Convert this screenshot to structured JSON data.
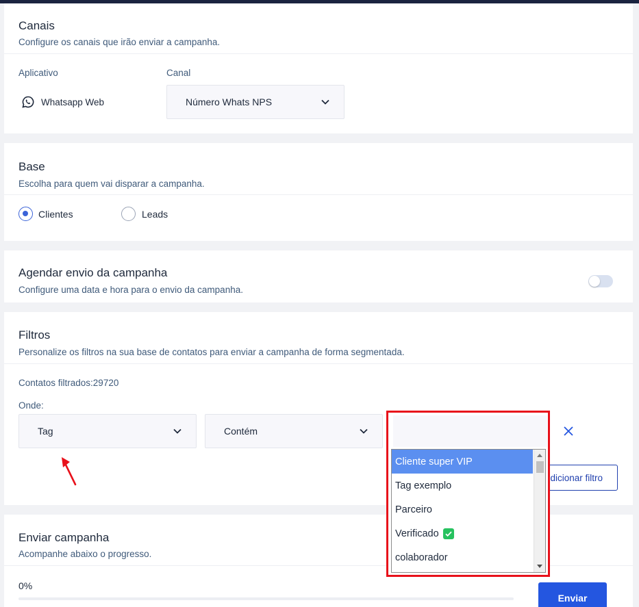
{
  "channels": {
    "title": "Canais",
    "subtitle": "Configure os canais que irão enviar a campanha.",
    "app_label": "Aplicativo",
    "app_name": "Whatsapp Web",
    "channel_label": "Canal",
    "channel_value": "Número Whats NPS"
  },
  "base": {
    "title": "Base",
    "subtitle": "Escolha para quem vai disparar a campanha.",
    "options": [
      {
        "label": "Clientes",
        "checked": true
      },
      {
        "label": "Leads",
        "checked": false
      }
    ]
  },
  "schedule": {
    "title": "Agendar envio da campanha",
    "subtitle": "Configure uma data e hora para o envio da campanha.",
    "enabled": false
  },
  "filters": {
    "title": "Filtros",
    "subtitle": "Personalize os filtros na sua base de contatos para enviar a campanha de forma segmentada.",
    "count_text": "Contatos filtrados:29720",
    "where_label": "Onde:",
    "field_value": "Tag",
    "operator_value": "Contém",
    "add_filter_label": "dicionar filtro",
    "dropdown_options": [
      {
        "label": "Cliente super VIP",
        "selected": true
      },
      {
        "label": "Tag exemplo",
        "selected": false
      },
      {
        "label": "Parceiro",
        "selected": false
      },
      {
        "label": "Verificado",
        "selected": false,
        "badge": "check-mark"
      },
      {
        "label": "colaborador",
        "selected": false
      }
    ]
  },
  "send": {
    "title": "Enviar campanha",
    "subtitle": "Acompanhe abaixo o progresso.",
    "progress_text": "0%",
    "progress": 0,
    "send_label": "Enviar"
  },
  "colors": {
    "accent": "#2456e0",
    "highlight_border": "#e8101a",
    "annotation_arrow": "#e8101a",
    "selected_option": "#5b8ff0"
  }
}
